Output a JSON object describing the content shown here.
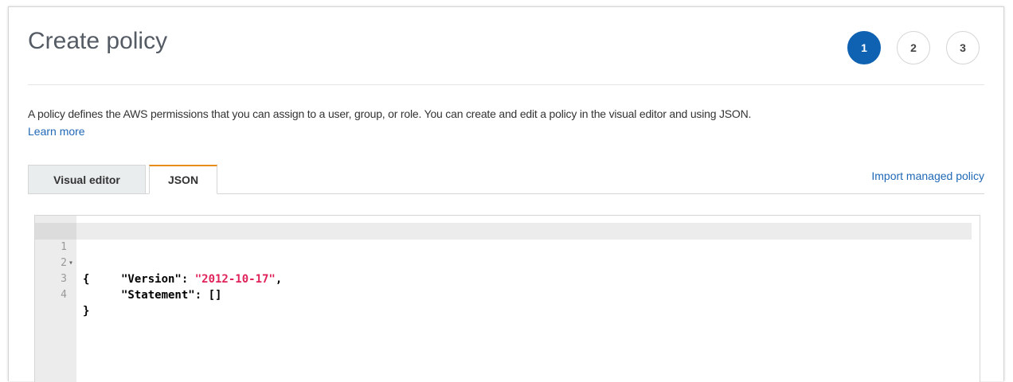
{
  "page": {
    "title": "Create policy"
  },
  "steps": [
    {
      "label": "1",
      "active": true
    },
    {
      "label": "2",
      "active": false
    },
    {
      "label": "3",
      "active": false
    }
  ],
  "description": "A policy defines the AWS permissions that you can assign to a user, group, or role. You can create and edit a policy in the visual editor and using JSON.",
  "learn_more": "Learn more",
  "tabs": {
    "visual_editor": "Visual editor",
    "json": "JSON",
    "active": "JSON"
  },
  "import_link": "Import managed policy",
  "editor": {
    "line_numbers": [
      "1",
      "2",
      "3",
      "4"
    ],
    "fold_marker": "▾",
    "lines": {
      "l1_open": "{",
      "l2_key": "\"Version\"",
      "l2_sep": ": ",
      "l2_value": "\"2012-10-17\"",
      "l2_comma": ",",
      "l3_key": "\"Statement\"",
      "l3_sep": ": ",
      "l3_value": "[]",
      "l4_close": "}"
    }
  },
  "colors": {
    "primary_step": "#0f62b1",
    "link": "#1f68b6",
    "active_tab_accent": "#e88b1d",
    "json_string": "#e0235a"
  }
}
